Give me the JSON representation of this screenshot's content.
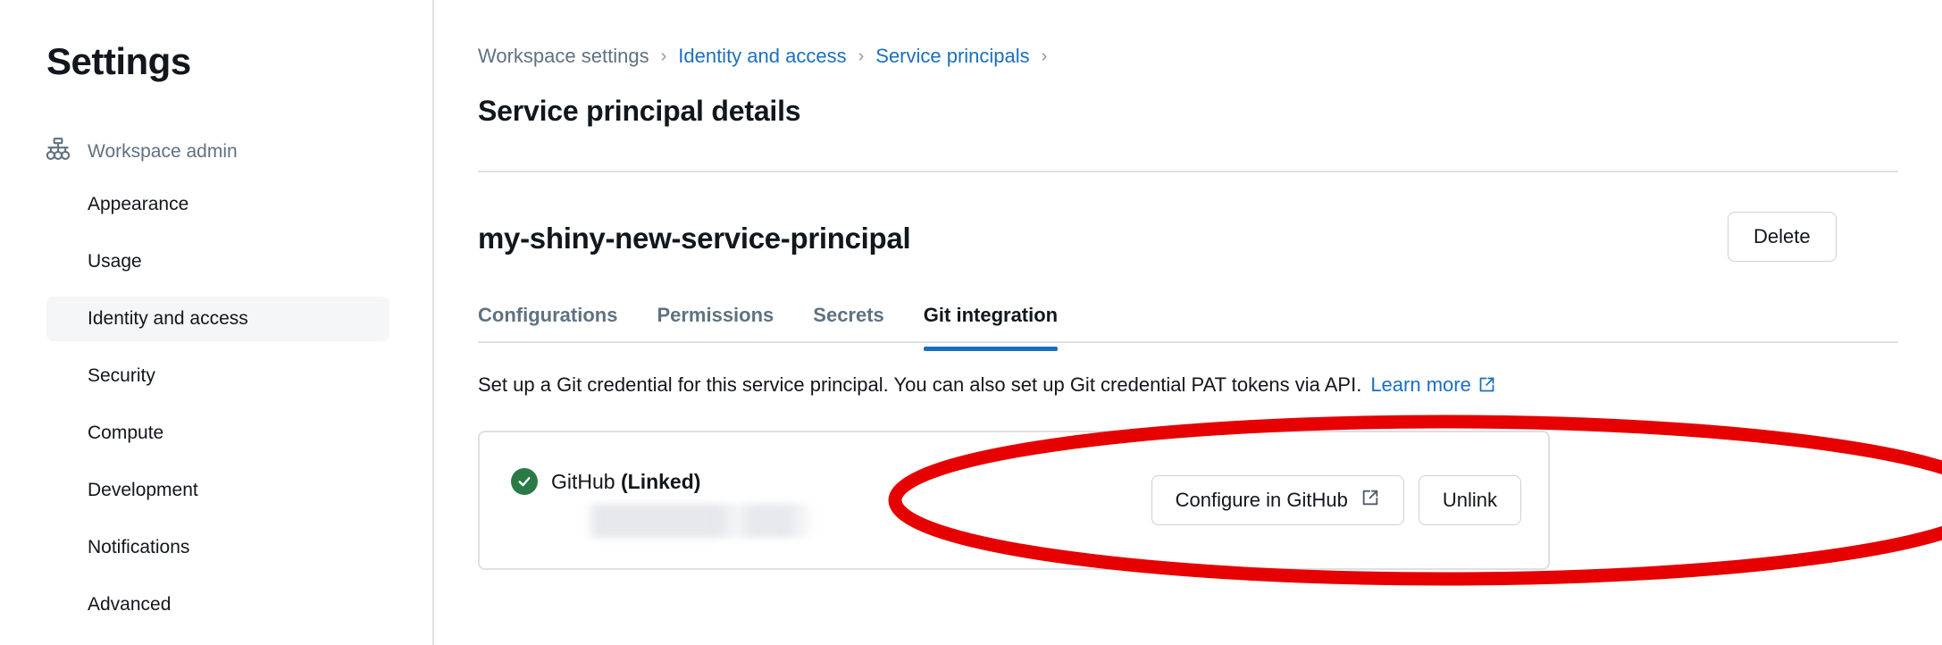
{
  "sidebar": {
    "title": "Settings",
    "group": {
      "icon": "hierarchy-icon",
      "label": "Workspace admin"
    },
    "items": [
      {
        "label": "Appearance",
        "active": false
      },
      {
        "label": "Usage",
        "active": false
      },
      {
        "label": "Identity and access",
        "active": true
      },
      {
        "label": "Security",
        "active": false
      },
      {
        "label": "Compute",
        "active": false
      },
      {
        "label": "Development",
        "active": false
      },
      {
        "label": "Notifications",
        "active": false
      },
      {
        "label": "Advanced",
        "active": false
      }
    ]
  },
  "main": {
    "breadcrumb": {
      "items": [
        {
          "label": "Workspace settings",
          "link": false
        },
        {
          "label": "Identity and access",
          "link": true
        },
        {
          "label": "Service principals",
          "link": true
        }
      ],
      "separator": "›",
      "trailing_separator": "›"
    },
    "page_title": "Service principal details",
    "entity_name": "my-shiny-new-service-principal",
    "delete_label": "Delete",
    "tabs": [
      {
        "label": "Configurations",
        "active": false
      },
      {
        "label": "Permissions",
        "active": false
      },
      {
        "label": "Secrets",
        "active": false
      },
      {
        "label": "Git integration",
        "active": true
      }
    ],
    "description": {
      "text": "Set up a Git credential for this service principal. You can also set up Git credential PAT tokens via API.",
      "link_label": "Learn more",
      "link_icon": "external-link-icon"
    },
    "git_card": {
      "status_icon": "check-circle-icon",
      "provider": "GitHub",
      "status": "(Linked)",
      "account_value": "",
      "account_redacted": true,
      "configure_label": "Configure in GitHub",
      "configure_icon": "external-link-icon",
      "unlink_label": "Unlink"
    }
  },
  "annotation": {
    "shape": "ellipse",
    "color": "#e60000",
    "target": "git-credential-card"
  },
  "colors": {
    "accent_link": "#1b6fbf",
    "tab_underline": "#1b6fbf",
    "success_green": "#2a7a45",
    "annotation_red": "#e60000",
    "text_primary": "#11171c",
    "text_muted": "#5f7281",
    "border": "#dce0e5"
  }
}
